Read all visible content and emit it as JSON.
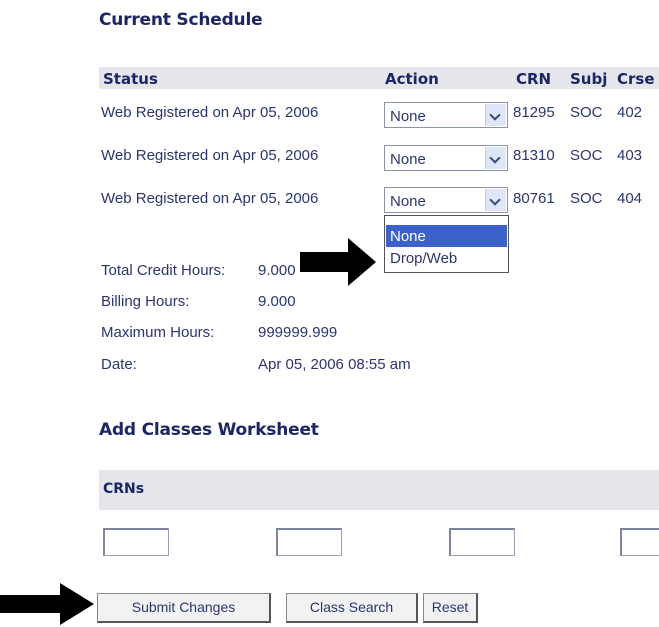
{
  "schedule": {
    "title": "Current Schedule",
    "headers": {
      "status": "Status",
      "action": "Action",
      "crn": "CRN",
      "subj": "Subj",
      "crse": "Crse"
    },
    "rows": [
      {
        "status": "Web Registered on Apr 05, 2006",
        "action": "None",
        "crn": "81295",
        "subj": "SOC",
        "crse": "402"
      },
      {
        "status": "Web Registered on Apr 05, 2006",
        "action": "None",
        "crn": "81310",
        "subj": "SOC",
        "crse": "403"
      },
      {
        "status": "Web Registered on Apr 05, 2006",
        "action": "None",
        "crn": "80761",
        "subj": "SOC",
        "crse": "404"
      }
    ],
    "dropdown_options": [
      "None",
      "Drop/Web"
    ]
  },
  "summary": {
    "total_credit_label": "Total Credit Hours:",
    "total_credit_value": "9.000",
    "billing_label": "Billing Hours:",
    "billing_value": "9.000",
    "max_label": "Maximum Hours:",
    "max_value": "999999.999",
    "date_label": "Date:",
    "date_value": "Apr 05, 2006 08:55 am"
  },
  "worksheet": {
    "title": "Add Classes Worksheet",
    "crns_label": "CRNs"
  },
  "buttons": {
    "submit": "Submit Changes",
    "class_search": "Class Search",
    "reset": "Reset"
  },
  "colors": {
    "heading": "#1c2566",
    "header_bg": "#e4e6ec",
    "selected_option": "#3a62c8"
  }
}
